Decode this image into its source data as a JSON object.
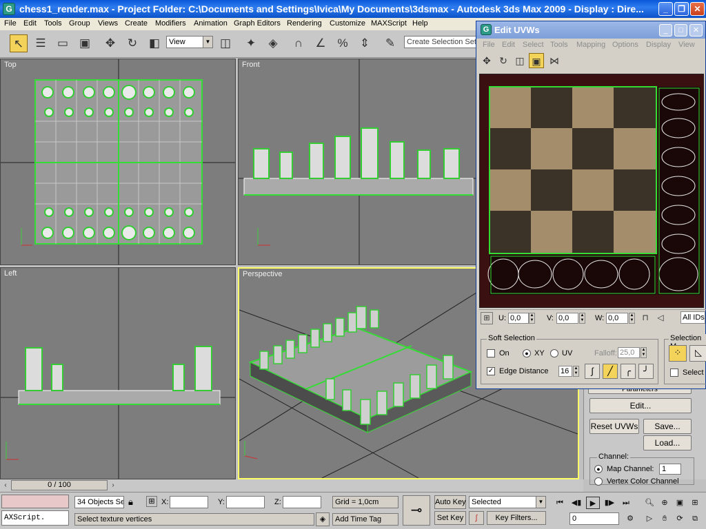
{
  "title": "chess1_render.max     - Project Folder: C:\\Documents and Settings\\Ivica\\My Documents\\3dsmax     - Autodesk 3ds Max  2009     - Display : Dire...",
  "menu": [
    "File",
    "Edit",
    "Tools",
    "Group",
    "Views",
    "Create",
    "Modifiers",
    "Animation",
    "Graph Editors",
    "Rendering",
    "Customize",
    "MAXScript",
    "Help"
  ],
  "toolbar": {
    "view_select": "View",
    "selection_set": "Create Selection Set"
  },
  "viewports": {
    "top": "Top",
    "front": "Front",
    "left": "Left",
    "perspective": "Perspective"
  },
  "uvw": {
    "title": "Edit UVWs",
    "menu": [
      "File",
      "Edit",
      "Select",
      "Tools",
      "Mapping",
      "Options",
      "Display",
      "View"
    ],
    "u_label": "U:",
    "u_value": "0,0",
    "v_label": "V:",
    "v_value": "0,0",
    "w_label": "W:",
    "w_value": "0,0",
    "ids": "All IDs",
    "soft_selection": {
      "title": "Soft Selection",
      "on": "On",
      "xy": "XY",
      "uv": "UV",
      "falloff_label": "Falloff:",
      "falloff_value": "25,0",
      "edge_distance": "Edge Distance",
      "edge_value": "16"
    },
    "selection_modes": {
      "title": "Selection M",
      "select": "Select"
    }
  },
  "command_panel": {
    "parameters": "Parameters",
    "edit": "Edit...",
    "reset": "Reset UVWs",
    "save": "Save...",
    "load": "Load...",
    "channel": "Channel:",
    "map_channel": "Map Channel:",
    "map_channel_value": "1",
    "vertex_color": "Vertex Color Channel"
  },
  "timeline": {
    "frame": "0 / 100"
  },
  "status": {
    "maxscript": "AXScript.",
    "objects": "34 Objects Se",
    "prompt": "Select texture vertices",
    "x_label": "X:",
    "y_label": "Y:",
    "z_label": "Z:",
    "grid": "Grid = 1,0cm",
    "add_time_tag": "Add Time Tag",
    "auto_key": "Auto Key",
    "set_key": "Set Key",
    "selected": "Selected",
    "key_filters": "Key Filters...",
    "frame_field": "0"
  }
}
